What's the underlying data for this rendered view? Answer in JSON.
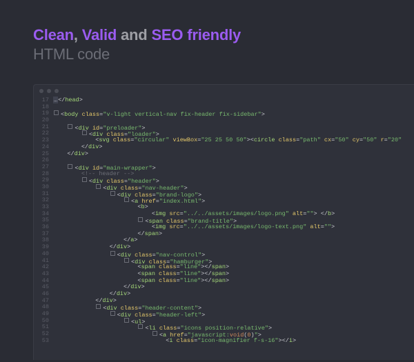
{
  "headline": {
    "word1": "Clean",
    "sep1": ", ",
    "word2": "Valid",
    "sep2": " and ",
    "word3": "SEO friendly",
    "subtitle": "HTML code"
  },
  "editor": {
    "first_line": 17,
    "lines": [
      {
        "i": 0,
        "html": "<span class='sel'>…</span><span class='punc'>&lt;/</span><span class='tag'>head</span><span class='punc'>&gt;</span>"
      },
      {
        "i": 0,
        "html": ""
      },
      {
        "i": 0,
        "html": "<span class='fold'></span><span class='punc'>&lt;</span><span class='tag'>body</span> <span class='attr'>class</span><span class='punc'>=</span><span class='str'>\"v-light vertical-nav fix-header fix-sidebar\"</span><span class='punc'>&gt;</span>"
      },
      {
        "i": 0,
        "html": ""
      },
      {
        "i": 1,
        "html": "<span class='fold'></span><span class='punc'>&lt;</span><span class='tag'>div</span> <span class='attr'>id</span><span class='punc'>=</span><span class='str'>\"preloader\"</span><span class='punc'>&gt;</span>"
      },
      {
        "i": 2,
        "html": "<span class='fold'></span><span class='punc'>&lt;</span><span class='tag'>div</span> <span class='attr'>class</span><span class='punc'>=</span><span class='str'>\"loader\"</span><span class='punc'>&gt;</span>"
      },
      {
        "i": 3,
        "html": "<span class='punc'>&lt;</span><span class='tag'>svg</span> <span class='attr'>class</span><span class='punc'>=</span><span class='str'>\"circular\"</span> <span class='attr'>viewBox</span><span class='punc'>=</span><span class='str'>\"25 25 50 50\"</span><span class='punc'>&gt;&lt;</span><span class='tag'>circle</span> <span class='attr'>class</span><span class='punc'>=</span><span class='str'>\"path\"</span> <span class='attr'>cx</span><span class='punc'>=</span><span class='str'>\"50\"</span> <span class='attr'>cy</span><span class='punc'>=</span><span class='str'>\"50\"</span> <span class='attr'>r</span><span class='punc'>=</span><span class='str'>\"20\"</span>"
      },
      {
        "i": 2,
        "html": "<span class='punc'>&lt;/</span><span class='tag'>div</span><span class='punc'>&gt;</span>"
      },
      {
        "i": 1,
        "html": "<span class='punc'>&lt;/</span><span class='tag'>div</span><span class='punc'>&gt;</span>"
      },
      {
        "i": 0,
        "html": ""
      },
      {
        "i": 1,
        "html": "<span class='fold'></span><span class='punc'>&lt;</span><span class='tag'>div</span> <span class='attr'>id</span><span class='punc'>=</span><span class='str'>\"main-wrapper\"</span><span class='punc'>&gt;</span>"
      },
      {
        "i": 2,
        "html": "<span class='cmt'>&lt;!-- header --&gt;</span>"
      },
      {
        "i": 2,
        "html": "<span class='fold'></span><span class='punc'>&lt;</span><span class='tag'>div</span> <span class='attr'>class</span><span class='punc'>=</span><span class='str'>\"header\"</span><span class='punc'>&gt;</span>"
      },
      {
        "i": 3,
        "html": "<span class='fold'></span><span class='punc'>&lt;</span><span class='tag'>div</span> <span class='attr'>class</span><span class='punc'>=</span><span class='str'>\"nav-header\"</span><span class='punc'>&gt;</span>"
      },
      {
        "i": 4,
        "html": "<span class='fold'></span><span class='punc'>&lt;</span><span class='tag'>div</span> <span class='attr'>class</span><span class='punc'>=</span><span class='str'>\"brand-logo\"</span><span class='punc'>&gt;</span>"
      },
      {
        "i": 5,
        "html": "<span class='fold'></span><span class='punc'>&lt;</span><span class='tag'>a</span> <span class='attr'>href</span><span class='punc'>=</span><span class='str'>\"index.html\"</span><span class='punc'>&gt;</span>"
      },
      {
        "i": 6,
        "html": "<span class='punc'>&lt;</span><span class='tag'>b</span><span class='punc'>&gt;</span>"
      },
      {
        "i": 7,
        "html": "<span class='punc'>&lt;</span><span class='tag'>img</span> <span class='attr'>src</span><span class='punc'>=</span><span class='str'>\"../../assets/images/logo.png\"</span> <span class='attr'>alt</span><span class='punc'>=</span><span class='str'>\"\"</span><span class='punc'>&gt; &lt;/</span><span class='tag'>b</span><span class='punc'>&gt;</span>"
      },
      {
        "i": 6,
        "html": "<span class='fold'></span><span class='punc'>&lt;</span><span class='tag'>span</span> <span class='attr'>class</span><span class='punc'>=</span><span class='str'>\"brand-title\"</span><span class='punc'>&gt;</span>"
      },
      {
        "i": 7,
        "html": "<span class='punc'>&lt;</span><span class='tag'>img</span> <span class='attr'>src</span><span class='punc'>=</span><span class='str'>\"../../assets/images/logo-text.png\"</span> <span class='attr'>alt</span><span class='punc'>=</span><span class='str'>\"\"</span><span class='punc'>&gt;</span>"
      },
      {
        "i": 6,
        "html": "<span class='punc'>&lt;/</span><span class='tag'>span</span><span class='punc'>&gt;</span>"
      },
      {
        "i": 5,
        "html": "<span class='punc'>&lt;/</span><span class='tag'>a</span><span class='punc'>&gt;</span>"
      },
      {
        "i": 4,
        "html": "<span class='punc'>&lt;/</span><span class='tag'>div</span><span class='punc'>&gt;</span>"
      },
      {
        "i": 4,
        "html": "<span class='fold'></span><span class='punc'>&lt;</span><span class='tag'>div</span> <span class='attr'>class</span><span class='punc'>=</span><span class='str'>\"nav-control\"</span><span class='punc'>&gt;</span>"
      },
      {
        "i": 5,
        "html": "<span class='fold'></span><span class='punc'>&lt;</span><span class='tag'>div</span> <span class='attr'>class</span><span class='punc'>=</span><span class='str'>\"hamburger\"</span><span class='punc'>&gt;</span>"
      },
      {
        "i": 6,
        "html": "<span class='punc'>&lt;</span><span class='tag'>span</span> <span class='attr'>class</span><span class='punc'>=</span><span class='str'>\"line\"</span><span class='punc'>&gt;&lt;/</span><span class='tag'>span</span><span class='punc'>&gt;</span>"
      },
      {
        "i": 6,
        "html": "<span class='punc'>&lt;</span><span class='tag'>span</span> <span class='attr'>class</span><span class='punc'>=</span><span class='str'>\"line\"</span><span class='punc'>&gt;&lt;/</span><span class='tag'>span</span><span class='punc'>&gt;</span>"
      },
      {
        "i": 6,
        "html": "<span class='punc'>&lt;</span><span class='tag'>span</span> <span class='attr'>class</span><span class='punc'>=</span><span class='str'>\"line\"</span><span class='punc'>&gt;&lt;/</span><span class='tag'>span</span><span class='punc'>&gt;</span>"
      },
      {
        "i": 5,
        "html": "<span class='punc'>&lt;/</span><span class='tag'>div</span><span class='punc'>&gt;</span>"
      },
      {
        "i": 4,
        "html": "<span class='punc'>&lt;/</span><span class='tag'>div</span><span class='punc'>&gt;</span>"
      },
      {
        "i": 3,
        "html": "<span class='punc'>&lt;/</span><span class='tag'>div</span><span class='punc'>&gt;</span>"
      },
      {
        "i": 3,
        "html": "<span class='fold'></span><span class='punc'>&lt;</span><span class='tag'>div</span> <span class='attr'>class</span><span class='punc'>=</span><span class='str'>\"header-content\"</span><span class='punc'>&gt;</span>"
      },
      {
        "i": 4,
        "html": "<span class='fold'></span><span class='punc'>&lt;</span><span class='tag'>div</span> <span class='attr'>class</span><span class='punc'>=</span><span class='str'>\"header-left\"</span><span class='punc'>&gt;</span>"
      },
      {
        "i": 5,
        "html": "<span class='fold'></span><span class='punc'>&lt;</span><span class='tag'>ul</span><span class='punc'>&gt;</span>"
      },
      {
        "i": 6,
        "html": "<span class='fold'></span><span class='punc'>&lt;</span><span class='tag'>li</span> <span class='attr'>class</span><span class='punc'>=</span><span class='str'>\"icons position-relative\"</span><span class='punc'>&gt;</span>"
      },
      {
        "i": 7,
        "html": "<span class='fold'></span><span class='punc'>&lt;</span><span class='tag'>a</span> <span class='attr'>href</span><span class='punc'>=</span><span class='str'>\"javascript:</span><span class='num'>void</span><span class='punc'>(</span><span class='num'>0</span><span class='punc'>)</span><span class='str'>\"</span><span class='punc'>&gt;</span>"
      },
      {
        "i": 8,
        "html": "<span class='punc'>&lt;</span><span class='tag'>i</span> <span class='attr'>class</span><span class='punc'>=</span><span class='str'>\"icon-magnifier f-s-16\"</span><span class='punc'>&gt;&lt;/</span><span class='tag'>i</span><span class='punc'>&gt;</span>"
      }
    ]
  }
}
